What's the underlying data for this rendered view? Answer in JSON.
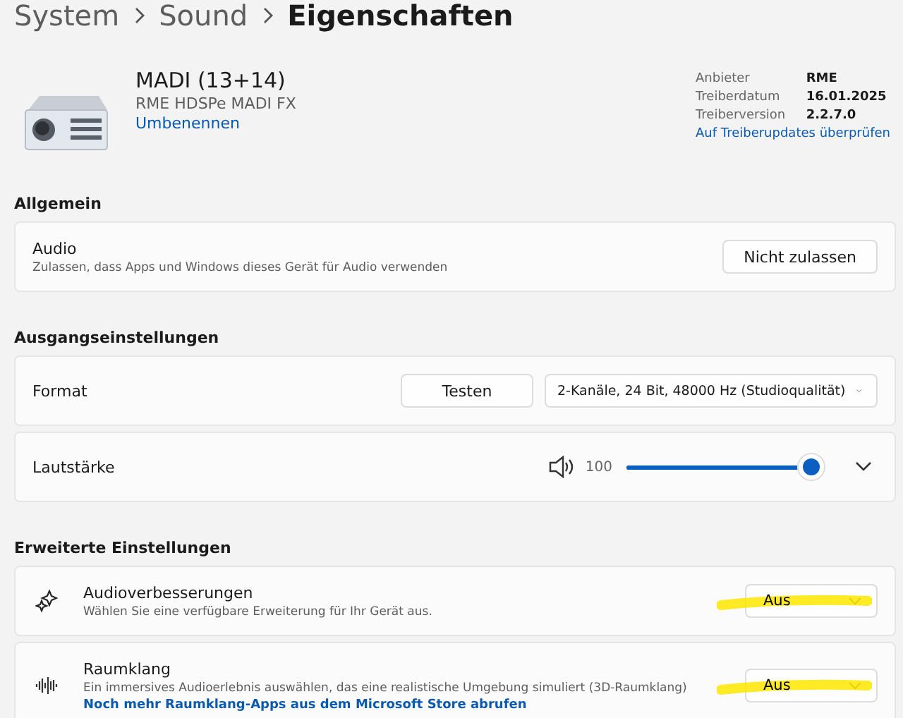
{
  "breadcrumb": [
    "System",
    "Sound",
    "Eigenschaften"
  ],
  "device": {
    "name": "MADI (13+14)",
    "model": "RME HDSPe MADI FX",
    "rename_link": "Umbenennen",
    "info": [
      {
        "label": "Anbieter",
        "value": "RME"
      },
      {
        "label": "Treiberdatum",
        "value": "16.01.2025"
      },
      {
        "label": "Treiberversion",
        "value": "2.2.7.0"
      }
    ],
    "update_link": "Auf Treiberupdates überprüfen"
  },
  "sections": [
    {
      "title": "Allgemein",
      "rows": [
        {
          "kind": "button",
          "title": "Audio",
          "description": "Zulassen, dass Apps und Windows dieses Gerät für Audio verwenden",
          "button": "Nicht zulassen"
        }
      ]
    },
    {
      "title": "Ausgangseinstellungen",
      "rows": [
        {
          "kind": "format",
          "title": "Format",
          "button": "Testen",
          "dropdown": "2-Kanäle, 24 Bit, 48000 Hz (Studioqualität)"
        },
        {
          "kind": "volume",
          "title": "Lautstärke",
          "reading": "100",
          "level": 0.98,
          "expanded": false
        }
      ]
    },
    {
      "title": "Erweiterte Einstellungen",
      "rows": [
        {
          "kind": "select",
          "title": "Audioverbesserungen",
          "description": "Wählen Sie eine verfügbare Erweiterung für Ihr Gerät aus.",
          "dropdown": "Aus",
          "highlighted": true
        },
        {
          "kind": "select",
          "title": "Raumklang",
          "description": "Ein immersives Audioerlebnis auswählen, das eine realistische Umgebung simuliert (3D-Raumklang)",
          "link": "Noch mehr Raumklang-Apps aus dem Microsoft Store abrufen",
          "dropdown": "Aus",
          "highlighted": true
        }
      ]
    }
  ]
}
